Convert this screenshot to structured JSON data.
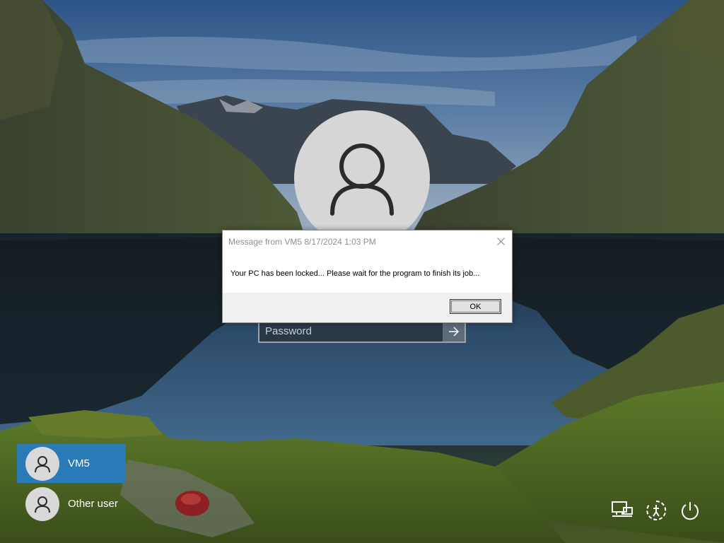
{
  "dialog": {
    "title": "Message from VM5 8/17/2024 1:03 PM",
    "message": "Your PC has been locked... Please wait for the program to finish its job...",
    "ok_label": "OK",
    "close_icon": "close-icon"
  },
  "login": {
    "password_placeholder": "Password",
    "submit_icon": "arrow-right-icon",
    "avatar_icon": "user-icon"
  },
  "users": [
    {
      "name": "VM5",
      "selected": true
    },
    {
      "name": "Other user",
      "selected": false
    }
  ],
  "system_buttons": [
    {
      "icon": "network-icon"
    },
    {
      "icon": "ease-of-access-icon"
    },
    {
      "icon": "power-icon"
    }
  ],
  "colors": {
    "selected_user_bg": "#2a7ab8",
    "avatar_bg": "#d6d6d6",
    "dialog_footer_bg": "#f0f0f0"
  }
}
